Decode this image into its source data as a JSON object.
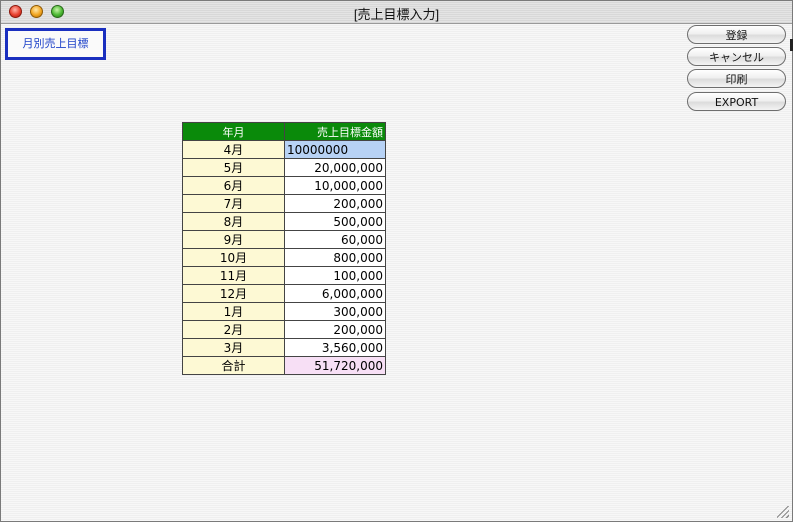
{
  "window": {
    "title": "[売上目標入力]"
  },
  "mode_label": "月別売上目標",
  "buttons": {
    "register": "登録",
    "cancel": "キャンセル",
    "print": "印刷",
    "export": "EXPORT"
  },
  "table": {
    "headers": [
      "年月",
      "売上目標金額"
    ],
    "rows": [
      {
        "month": "4月",
        "amount": "10000000"
      },
      {
        "month": "5月",
        "amount": "20,000,000"
      },
      {
        "month": "6月",
        "amount": "10,000,000"
      },
      {
        "month": "7月",
        "amount": "200,000"
      },
      {
        "month": "8月",
        "amount": "500,000"
      },
      {
        "month": "9月",
        "amount": "60,000"
      },
      {
        "month": "10月",
        "amount": "800,000"
      },
      {
        "month": "11月",
        "amount": "100,000"
      },
      {
        "month": "12月",
        "amount": "6,000,000"
      },
      {
        "month": "1月",
        "amount": "300,000"
      },
      {
        "month": "2月",
        "amount": "200,000"
      },
      {
        "month": "3月",
        "amount": "3,560,000"
      }
    ],
    "total": {
      "label": "合計",
      "amount": "51,720,000"
    }
  },
  "colors": {
    "header_bg": "#0a8a0a",
    "month_bg": "#fdf9d4",
    "editing_bg": "#b7d2f5",
    "total_bg": "#f7dff5",
    "mode_border": "#1a2fbf"
  }
}
